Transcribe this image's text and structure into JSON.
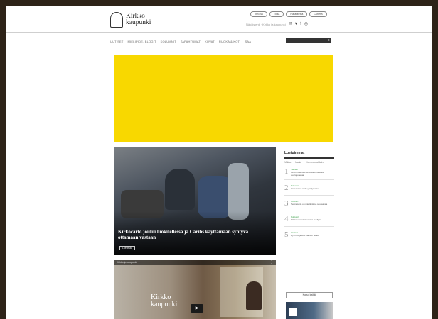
{
  "brand": {
    "line1": "Kirkko",
    "line2": "kaupunki"
  },
  "topbar": {
    "buttons": [
      "Ilmoita",
      "Tilaa",
      "Palautetta",
      "Lähetä"
    ],
    "subtext": "Näköislehti · Kirkko ja kaupunki"
  },
  "social": [
    "✉",
    "♥",
    "f",
    "◎"
  ],
  "nav": [
    "UUTISET",
    "MIELIPIDE, BLOGIT",
    "KOLUMNIT",
    "TAPAHTUMAT",
    "KUVAT",
    "RUOKA & KOTI",
    "SAA"
  ],
  "search": {
    "placeholder": "",
    "icon": "search-icon"
  },
  "banner": {
    "color": "#f8d800"
  },
  "hero": {
    "title": "Kirkocarto joutui luokitellessa ja Caribs käyttämään syntyvä ottamaan vastaan",
    "button": "Lue lisää"
  },
  "popular": {
    "title": "Luetuimmat",
    "tabs": [
      "Viikko",
      "Uusin",
      "Kommentoiduin"
    ],
    "items": [
      {
        "num": "1",
        "cat": "Yleinen",
        "text": "Kirkon tutkimus tarkoittaa kristillistä vuoropuhelua"
      },
      {
        "num": "2",
        "cat": "Kolumni",
        "text": "Oma tarina ei ole yksityisasia"
      },
      {
        "num": "3",
        "cat": "Uutinen",
        "text": "Seurakunta on miettimässä seuraavaa"
      },
      {
        "num": "4",
        "cat": "Kulttuuri",
        "text": "Kirkkokonsertti haastaa kuulijan"
      },
      {
        "num": "5",
        "cat": "Ihmiset",
        "text": "Hyvin kuljetettu elämän polku"
      }
    ],
    "more": "Katso kaikki"
  },
  "video": {
    "caption": "Kirkko ja kaupunki",
    "menu": "⋮",
    "logo_line1": "Kirkko",
    "logo_line2": "kaupunki"
  }
}
